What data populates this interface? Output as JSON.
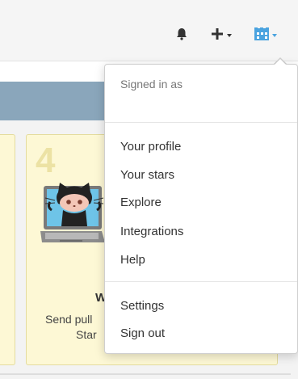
{
  "header": {
    "notifications_icon": "bell-icon",
    "create_icon": "plus-icon",
    "avatar_icon": "avatar-identicon",
    "accent": "#4aa3df"
  },
  "card": {
    "step_number": "4",
    "title_fragment": "W",
    "text_line1": "Send pull",
    "text_line2": "Star"
  },
  "dropdown": {
    "signed_in_label": "Signed in as",
    "items_group1": [
      "Your profile",
      "Your stars",
      "Explore",
      "Integrations",
      "Help"
    ],
    "items_group2": [
      "Settings",
      "Sign out"
    ]
  }
}
